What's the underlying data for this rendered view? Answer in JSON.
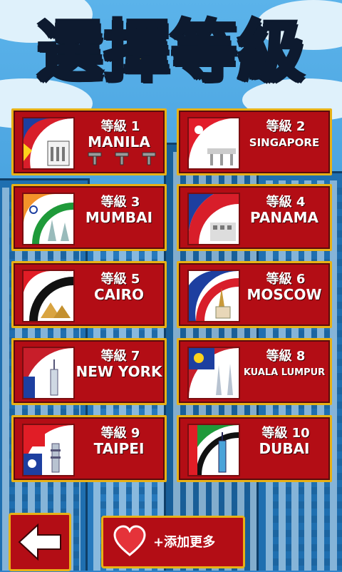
{
  "title": "選擇等級",
  "levels": [
    {
      "level": "等級 1",
      "city": "MANILA",
      "locked_keys": 3
    },
    {
      "level": "等級 2",
      "city": "SINGAPORE"
    },
    {
      "level": "等級 3",
      "city": "MUMBAI"
    },
    {
      "level": "等級 4",
      "city": "PANAMA"
    },
    {
      "level": "等級 5",
      "city": "CAIRO"
    },
    {
      "level": "等級 6",
      "city": "MOSCOW"
    },
    {
      "level": "等級 7",
      "city": "NEW YORK"
    },
    {
      "level": "等級 8",
      "city": "KUALA LUMPUR"
    },
    {
      "level": "等級 9",
      "city": "TAIPEI"
    },
    {
      "level": "等級 10",
      "city": "DUBAI"
    }
  ],
  "more_button": "+添加更多",
  "colors": {
    "card": "#b30d15",
    "border": "#e8b116",
    "title": "#ffe22a",
    "sky": "#2f84cc"
  }
}
